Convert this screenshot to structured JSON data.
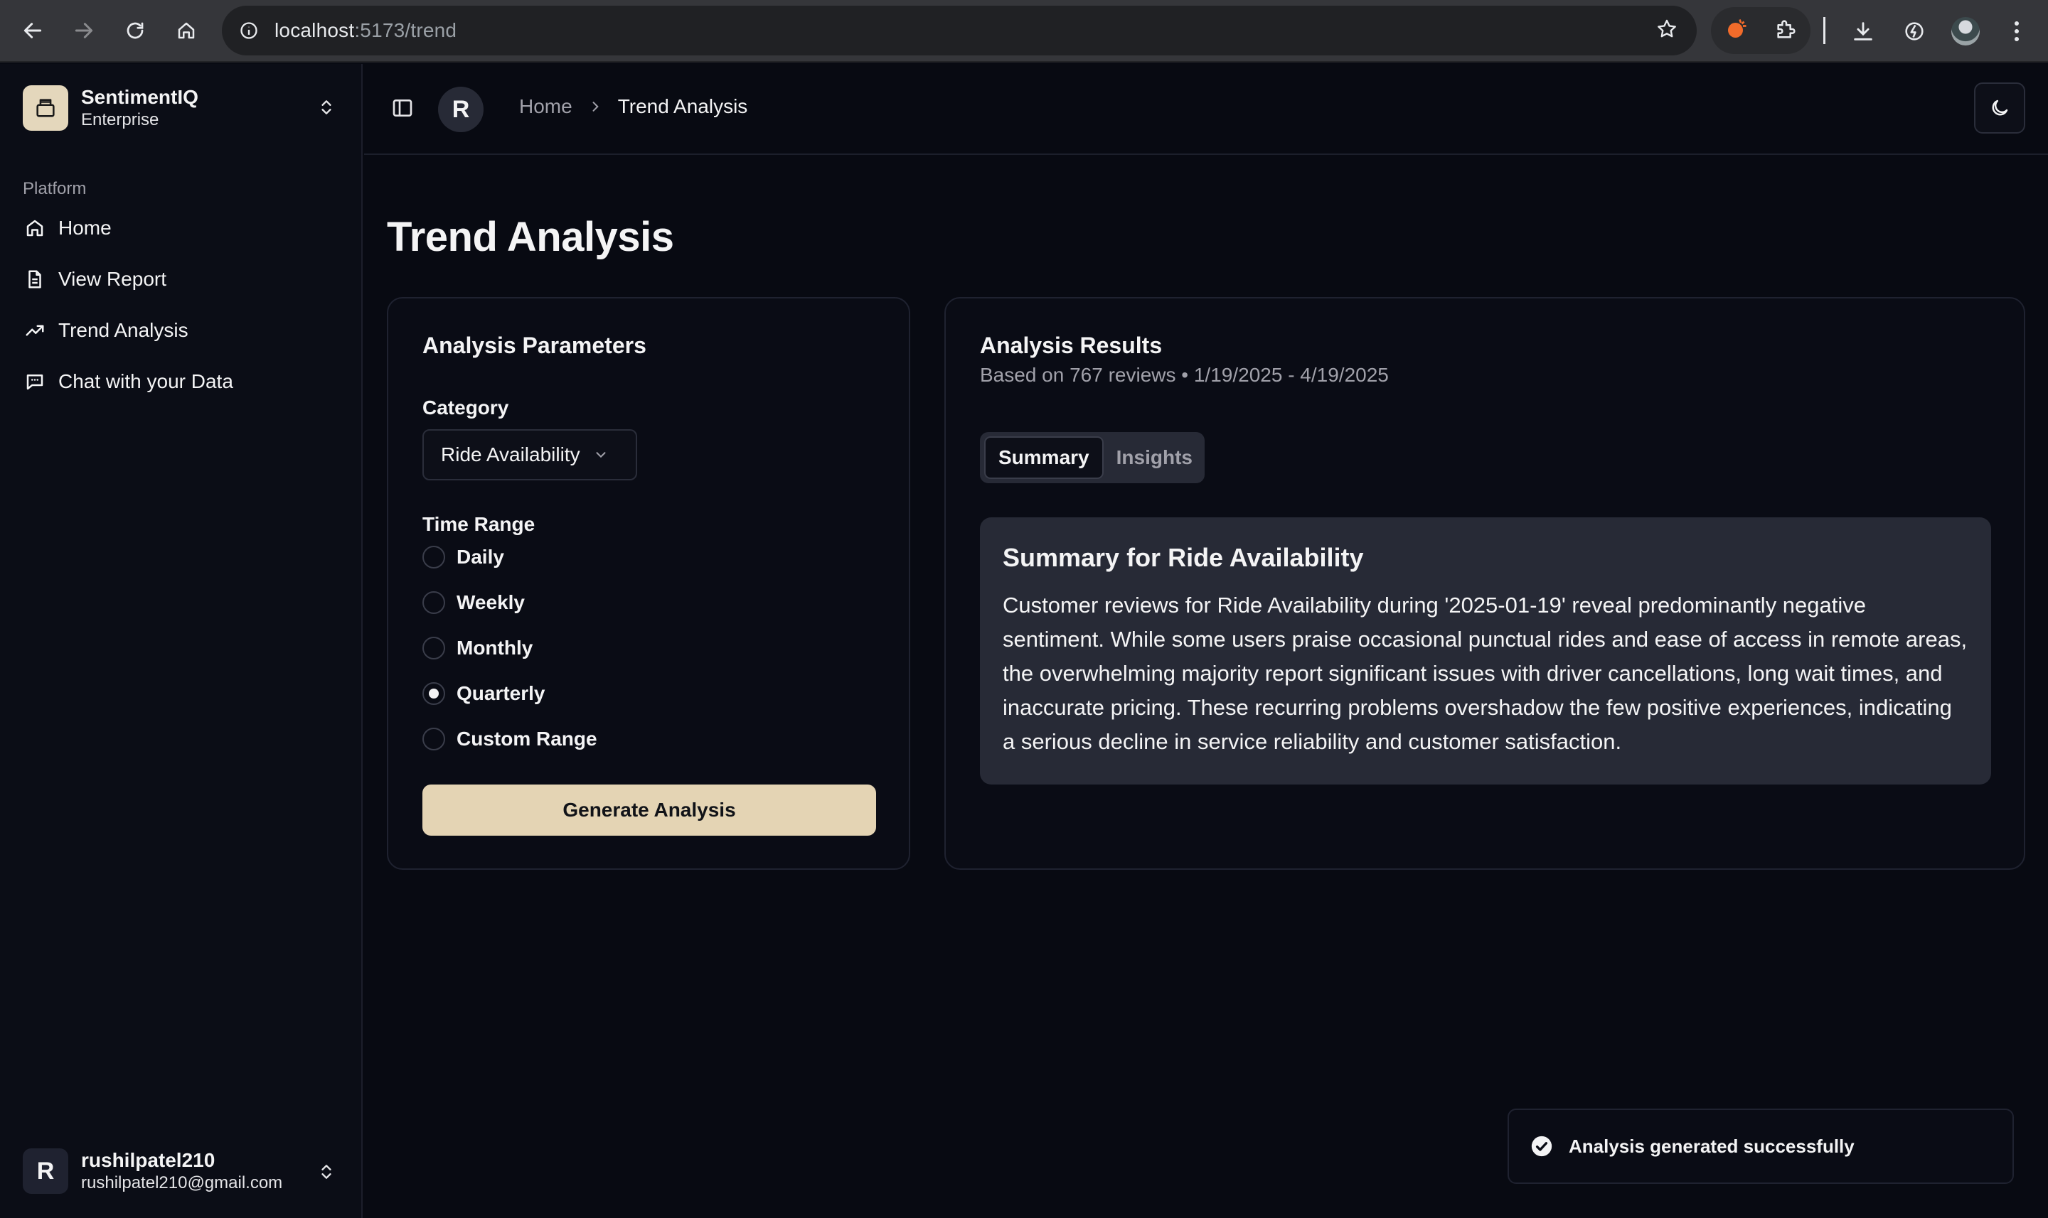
{
  "browser": {
    "url_host": "localhost",
    "url_path": ":5173/trend"
  },
  "sidebar": {
    "brand_name": "SentimentIQ",
    "brand_plan": "Enterprise",
    "group_label": "Platform",
    "items": [
      {
        "label": "Home",
        "icon": "home-icon"
      },
      {
        "label": "View Report",
        "icon": "file-icon"
      },
      {
        "label": "Trend Analysis",
        "icon": "trend-icon"
      },
      {
        "label": "Chat with your Data",
        "icon": "chat-icon"
      }
    ],
    "user": {
      "initial": "R",
      "name": "rushilpatel210",
      "email": "rushilpatel210@gmail.com"
    }
  },
  "header": {
    "avatar_initial": "R",
    "breadcrumb": [
      "Home",
      "Trend Analysis"
    ]
  },
  "page": {
    "title": "Trend Analysis"
  },
  "params": {
    "title": "Analysis Parameters",
    "category_label": "Category",
    "category_value": "Ride Availability",
    "time_range_label": "Time Range",
    "time_range_options": [
      {
        "label": "Daily",
        "selected": false
      },
      {
        "label": "Weekly",
        "selected": false
      },
      {
        "label": "Monthly",
        "selected": false
      },
      {
        "label": "Quarterly",
        "selected": true
      },
      {
        "label": "Custom Range",
        "selected": false
      }
    ],
    "generate_label": "Generate Analysis"
  },
  "results": {
    "title": "Analysis Results",
    "subtitle": "Based on 767 reviews • 1/19/2025 - 4/19/2025",
    "tabs": [
      "Summary",
      "Insights"
    ],
    "active_tab": "Summary",
    "summary_title": "Summary for Ride Availability",
    "summary_text": "Customer reviews for Ride Availability during '2025-01-19' reveal predominantly negative sentiment. While some users praise occasional punctual rides and ease of access in remote areas, the overwhelming majority report significant issues with driver cancellations, long wait times, and inaccurate pricing. These recurring problems overshadow the few positive experiences, indicating a serious decline in service reliability and customer satisfaction."
  },
  "toast": {
    "message": "Analysis generated successfully"
  },
  "colors": {
    "background": "#080a12",
    "accent_button": "#e4d4b4",
    "brand_logo": "#e4d7bc",
    "summary_box": "#272a36"
  }
}
